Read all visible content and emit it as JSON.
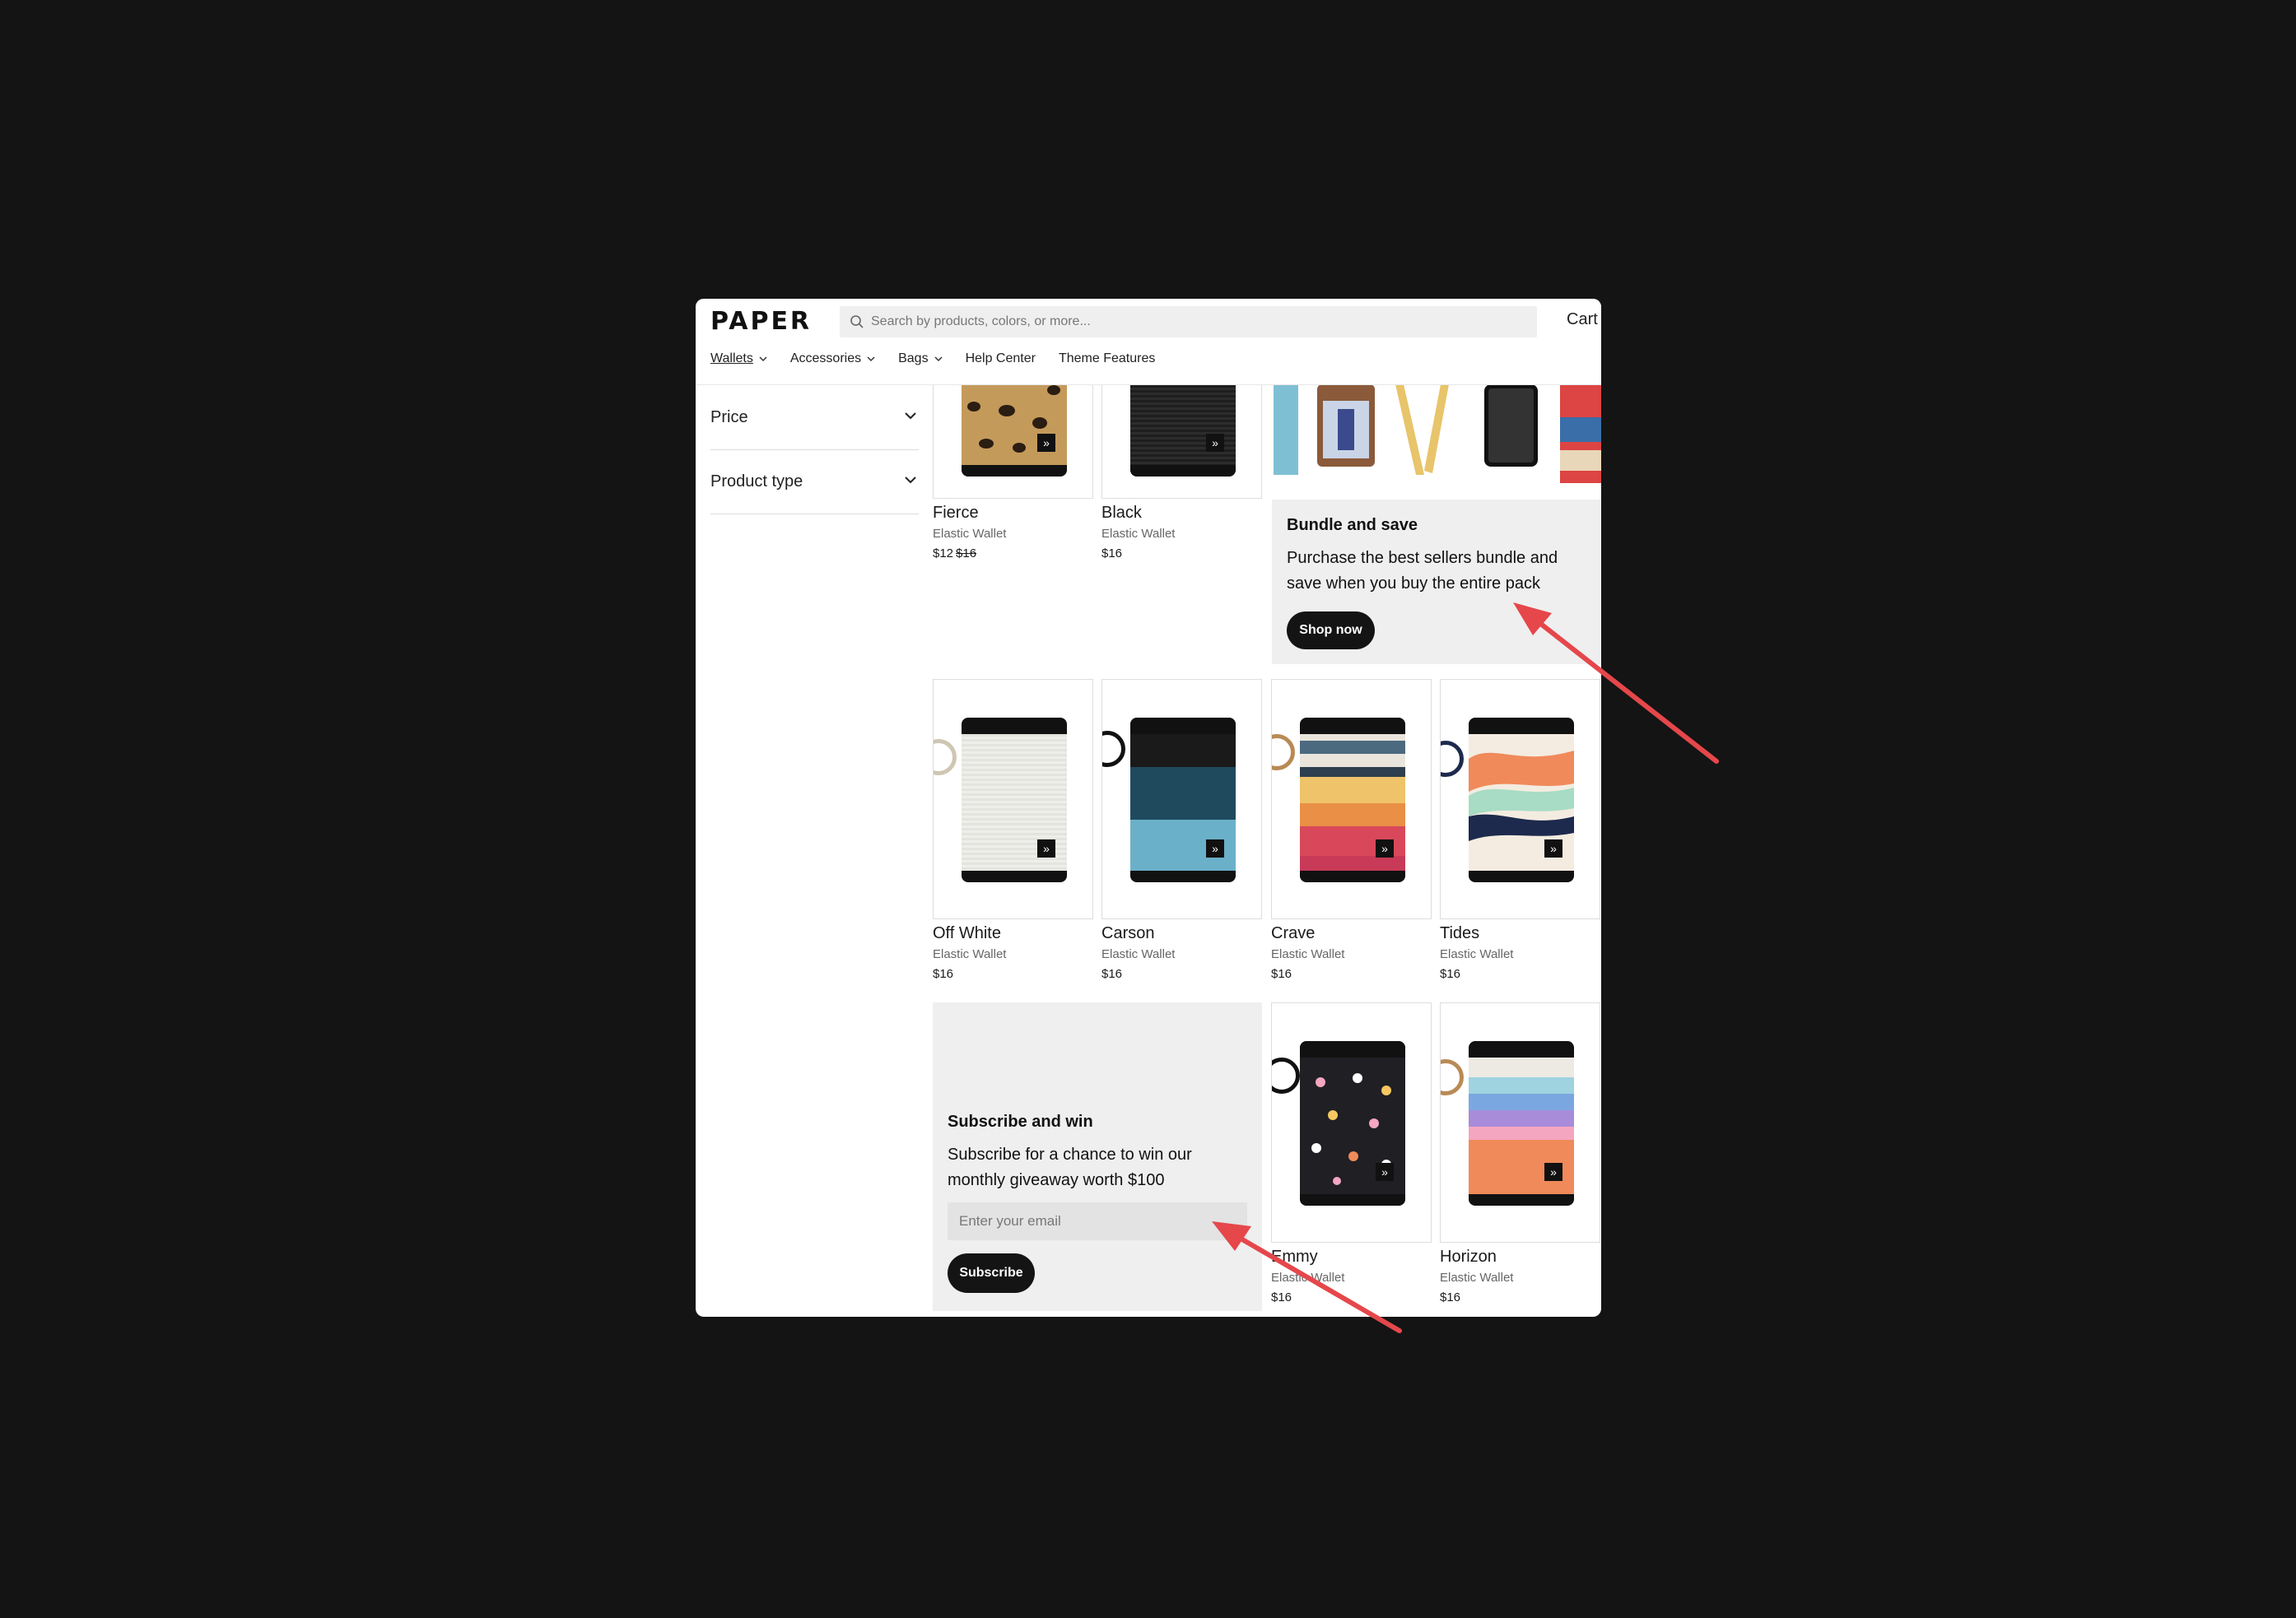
{
  "brand": {
    "logo": "PAPER"
  },
  "header": {
    "search_placeholder": "Search by products, colors, or more...",
    "cart_label": "Cart",
    "nav": [
      {
        "label": "Wallets",
        "has_menu": true,
        "active": true
      },
      {
        "label": "Accessories",
        "has_menu": true
      },
      {
        "label": "Bags",
        "has_menu": true
      },
      {
        "label": "Help Center",
        "has_menu": false
      },
      {
        "label": "Theme Features",
        "has_menu": false
      }
    ]
  },
  "filters": [
    {
      "label": "Price"
    },
    {
      "label": "Product type"
    }
  ],
  "products": [
    {
      "name": "Fierce",
      "type": "Elastic Wallet",
      "price": "$12",
      "compare_price": "$16"
    },
    {
      "name": "Black",
      "type": "Elastic Wallet",
      "price": "$16"
    },
    {
      "name": "Off White",
      "type": "Elastic Wallet",
      "price": "$16"
    },
    {
      "name": "Carson",
      "type": "Elastic Wallet",
      "price": "$16"
    },
    {
      "name": "Crave",
      "type": "Elastic Wallet",
      "price": "$16"
    },
    {
      "name": "Tides",
      "type": "Elastic Wallet",
      "price": "$16"
    },
    {
      "name": "Emmy",
      "type": "Elastic Wallet",
      "price": "$16"
    },
    {
      "name": "Horizon",
      "type": "Elastic Wallet",
      "price": "$16"
    }
  ],
  "bundle_promo": {
    "title": "Bundle and save",
    "text_line1": "Purchase the best sellers bundle and",
    "text_line2": "save when you buy the entire pack",
    "button": "Shop now"
  },
  "subscribe_promo": {
    "title": "Subscribe and win",
    "text_line1": "Subscribe for a chance to win our",
    "text_line2": "monthly giveaway worth $100",
    "email_placeholder": "Enter your email",
    "button": "Subscribe"
  },
  "icons": {
    "search": "search-icon",
    "chevron": "chevron-down-icon",
    "quick_add": "double-chevron-right-icon"
  },
  "colors": {
    "accent_dark": "#141414",
    "annotation_arrow": "#e5474b",
    "promo_bg": "#efefef"
  }
}
